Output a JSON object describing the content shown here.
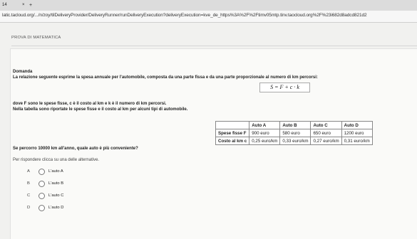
{
  "browser": {
    "tab_title": "14",
    "tab_close": "×",
    "new_tab": "+",
    "url": "latic.tacloud.org/.../n/zoy/tilDeliveryProvider/DeliveryRunner/runDeliveryExecution?deliveryExecution=kve_de_https%3A%2F%2Ftimv05mtp.tinv.taocloud.org%2F%23i682d8adcd821d2"
  },
  "header": {
    "title": "PROVA DI MATEMATICA"
  },
  "question": {
    "section": "Domanda",
    "intro": "La relazione seguente esprime la spesa annuale per l'automobile, composta da una parte fissa e da una parte proporzionale al numero di km percorsi:",
    "formula": "S = F + c · k",
    "where": "dove F sono le spese fisse, c è il costo al km e k è il numero di km percorsi.",
    "table_intro": "Nella tabella sono riportate le spese fisse e il costo al km per alcuni tipi di automobile.",
    "table": {
      "columns": [
        "Auto A",
        "Auto B",
        "Auto C",
        "Auto D"
      ],
      "rows": [
        {
          "label": "Spese fisse F",
          "values": [
            "900 euro",
            "580 euro",
            "650 euro",
            "1200 euro"
          ]
        },
        {
          "label": "Costo al km c",
          "values": [
            "0,25 euro/km",
            "0,33 euro/km",
            "0,27 euro/km",
            "0,31 euro/km"
          ]
        }
      ]
    },
    "prompt": "Se percorro 10000 km all'anno, quale auto è più conveniente?",
    "instruction": "Per rispondere clicca su una delle alternative.",
    "options": [
      {
        "letter": "A",
        "label": "L'auto A"
      },
      {
        "letter": "B",
        "label": "L'auto B"
      },
      {
        "letter": "C",
        "label": "L'auto C"
      },
      {
        "letter": "D",
        "label": "L'auto D"
      }
    ]
  }
}
